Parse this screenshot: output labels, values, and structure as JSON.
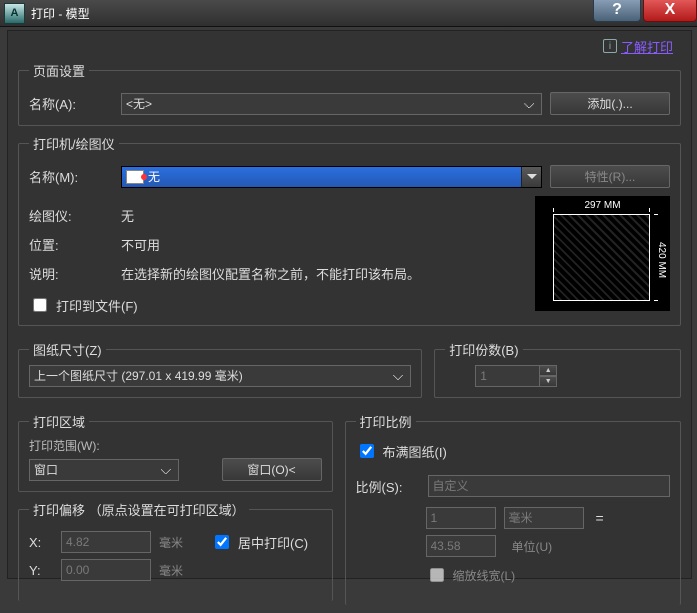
{
  "window": {
    "title": "打印 - 模型",
    "help_glyph": "?",
    "close_glyph": "X",
    "app_icon_letter": "A"
  },
  "learn": {
    "info_glyph": "i",
    "link_text": "了解打印"
  },
  "page_setup": {
    "legend": "页面设置",
    "name_label": "名称(A):",
    "name_value": "<无>",
    "add_button": "添加(.)..."
  },
  "plotter": {
    "legend": "打印机/绘图仪",
    "name_label": "名称(M):",
    "name_value": "无",
    "props_button": "特性(R)...",
    "device_label": "绘图仪:",
    "device_value": "无",
    "location_label": "位置:",
    "location_value": "不可用",
    "desc_label": "说明:",
    "desc_value": "在选择新的绘图仪配置名称之前，不能打印该布局。",
    "to_file_label": "打印到文件(F)",
    "preview_w": "297 MM",
    "preview_h": "420 MM"
  },
  "paper": {
    "legend": "图纸尺寸(Z)",
    "value": "上一个图纸尺寸 (297.01 x 419.99 毫米)"
  },
  "copies": {
    "legend": "打印份数(B)",
    "value": "1"
  },
  "area": {
    "legend": "打印区域",
    "range_label": "打印范围(W):",
    "range_value": "窗口",
    "window_button": "窗口(O)<"
  },
  "scale": {
    "legend": "打印比例",
    "fit_label": "布满图纸(I)",
    "scale_label": "比例(S):",
    "scale_value": "自定义",
    "unit_val": "1",
    "unit_sel": "毫米",
    "drawing_val": "43.58",
    "drawing_unit_label": "单位(U)",
    "scale_lw_label": "缩放线宽(L)"
  },
  "offset": {
    "legend": "打印偏移 （原点设置在可打印区域）",
    "x_label": "X:",
    "x_value": "4.82",
    "x_unit": "毫米",
    "y_label": "Y:",
    "y_value": "0.00",
    "y_unit": "毫米",
    "center_label": "居中打印(C)"
  }
}
